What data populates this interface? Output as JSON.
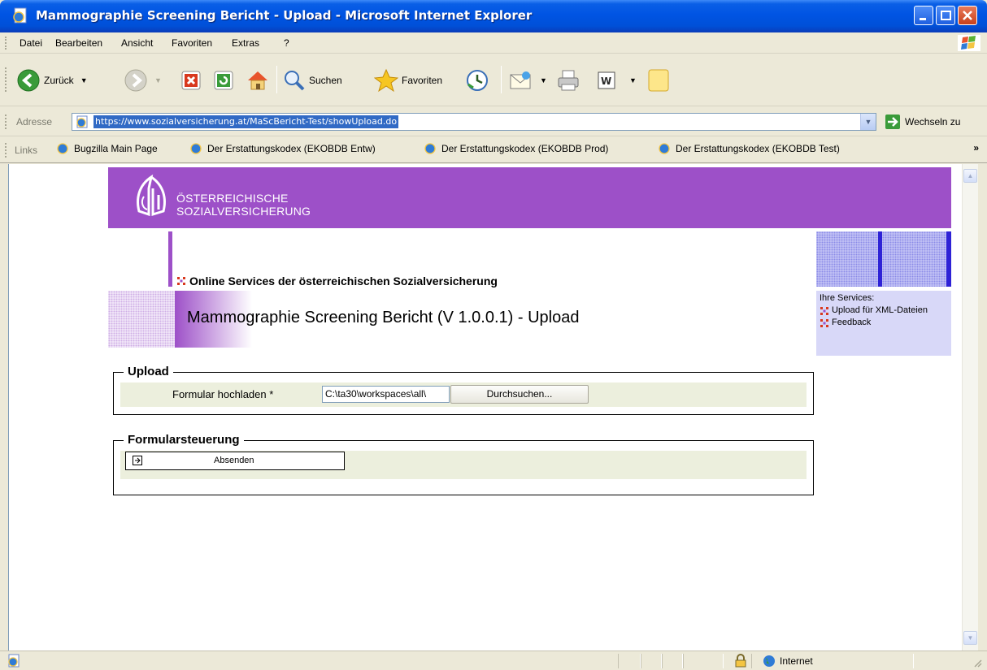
{
  "window": {
    "title": "Mammographie Screening Bericht - Upload - Microsoft Internet Explorer"
  },
  "menu": {
    "items": [
      "Datei",
      "Bearbeiten",
      "Ansicht",
      "Favoriten",
      "Extras",
      "?"
    ]
  },
  "toolbar": {
    "back_label": "Zurück",
    "search_label": "Suchen",
    "favorites_label": "Favoriten"
  },
  "address": {
    "label": "Adresse",
    "url": "https://www.sozialversicherung.at/MaScBericht-Test/showUpload.do",
    "go_label": "Wechseln zu"
  },
  "links": {
    "label": "Links",
    "items": [
      "Bugzilla Main Page",
      "Der Erstattungskodex (EKOBDB Entw)",
      "Der Erstattungskodex (EKOBDB Prod)",
      "Der Erstattungskodex (EKOBDB Test)"
    ]
  },
  "page": {
    "org_name_line1": "ÖSTERREICHISCHE",
    "org_name_line2": "SOZIALVERSICHERUNG",
    "online_services": "Online Services der österreichischen Sozialversicherung",
    "title": "Mammographie Screening Bericht (V 1.0.0.1) - Upload",
    "services": {
      "heading": "Ihre Services:",
      "links": [
        "Upload für XML-Dateien",
        "Feedback"
      ]
    },
    "upload": {
      "legend": "Upload",
      "field_label": "Formular hochladen *",
      "file_value": "C:\\ta30\\workspaces\\all\\",
      "browse_label": "Durchsuchen..."
    },
    "control": {
      "legend": "Formularsteuerung",
      "submit_label": "Absenden"
    }
  },
  "status": {
    "zone": "Internet"
  },
  "colors": {
    "brand_purple": "#9d50c8",
    "deco_blue": "#2e22d6",
    "services_bg": "#d8d8f8",
    "row_bg": "#ecefdd"
  }
}
